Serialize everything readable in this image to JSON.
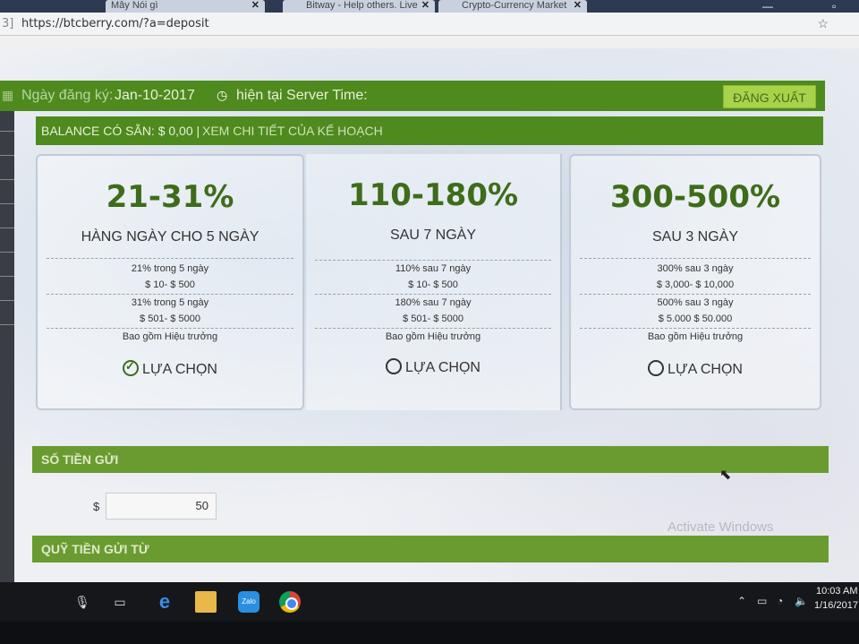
{
  "browser": {
    "tabs": [
      {
        "title": "Mây Nói gì",
        "close": "✕"
      },
      {
        "title": "Bitway - Help others. Live",
        "close": "✕"
      },
      {
        "title": "Crypto-Currency Market",
        "close": "✕"
      }
    ],
    "url": "https://btcberry.com/?a=deposit",
    "url_prefix": "3]"
  },
  "header": {
    "registered_label": "Ngày đăng ký:",
    "registered_date": "Jan-10-2017",
    "server_time_label": "hiện tại Server Time:",
    "logout_label": "ĐĂNG XUẤT"
  },
  "balance": {
    "label": "BALANCE CÓ SẴN: $ 0,00 |",
    "details_link": "XEM CHI TIẾT CỦA KẾ HOẠCH"
  },
  "plans": [
    {
      "percent": "21-31%",
      "period": "HÀNG NGÀY CHO 5 NGÀY",
      "lines": [
        "21% trong 5 ngày",
        "$ 10- $ 500",
        "31% trong 5 ngày",
        "$ 501- $ 5000",
        "Bao gồm Hiệu trưởng"
      ],
      "choose_label": "LỰA CHỌN",
      "selected": true
    },
    {
      "percent": "110-180%",
      "period": "SAU 7 NGÀY",
      "lines": [
        "110% sau 7 ngày",
        "$ 10- $ 500",
        "180% sau 7 ngày",
        "$ 501- $ 5000",
        "Bao gồm Hiệu trưởng"
      ],
      "choose_label": "LỰA CHỌN",
      "selected": false
    },
    {
      "percent": "300-500%",
      "period": "SAU 3 NGÀY",
      "lines": [
        "300% sau 3 ngày",
        "$ 3,000- $ 10,000",
        "500% sau 3 ngày",
        "$ 5.000 $ 50.000",
        "Bao gồm Hiệu trưởng"
      ],
      "choose_label": "LỰA CHỌN",
      "selected": false
    }
  ],
  "deposit": {
    "section_title": "SỐ TIỀN GỬI",
    "currency_symbol": "$",
    "amount": "50",
    "fund_section_title": "QUỸ TIỀN GỬI TỪ"
  },
  "watermark": "Activate Windows",
  "taskbar": {
    "time": "10:03 AM",
    "date": "1/16/2017",
    "zalo_label": "Zalo"
  }
}
